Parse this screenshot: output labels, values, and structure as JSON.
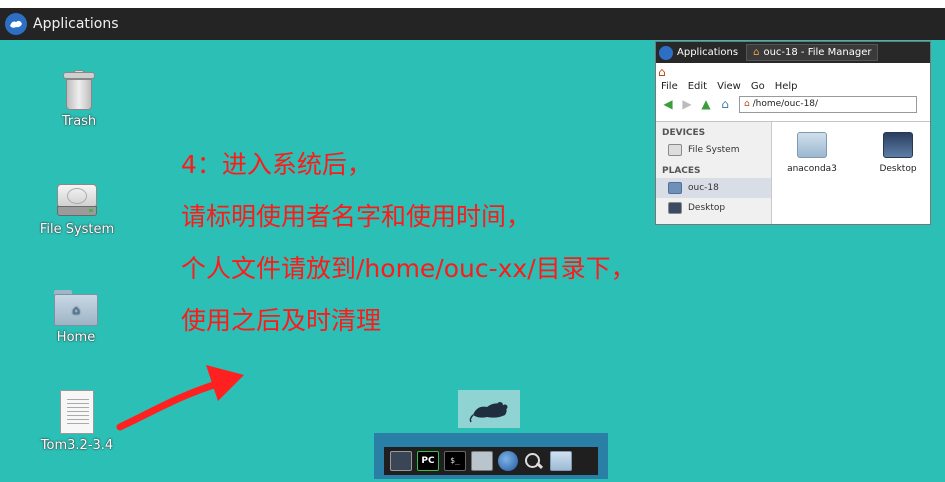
{
  "topbar": {
    "label": "Applications"
  },
  "desktop": {
    "icons": [
      {
        "label": "Trash"
      },
      {
        "label": "File System"
      },
      {
        "label": "Home"
      },
      {
        "label": "Tom3.2-3.4"
      }
    ]
  },
  "annotation": {
    "lines": [
      "4：进入系统后，",
      "请标明使用者名字和使用时间，",
      "个人文件请放到/home/ouc-xx/目录下，",
      "使用之后及时清理"
    ],
    "color": "#ff1a1a"
  },
  "file_manager": {
    "applications_label": "Applications",
    "task_title": "ouc-18 - File Manager",
    "menu": [
      "File",
      "Edit",
      "View",
      "Go",
      "Help"
    ],
    "address": "/home/ouc-18/",
    "devices_header": "DEVICES",
    "devices": [
      "File System"
    ],
    "places_header": "PLACES",
    "places": [
      "ouc-18",
      "Desktop"
    ],
    "files": [
      "anaconda3",
      "Desktop"
    ]
  },
  "dock": {
    "pc_label": "PC",
    "terminal_label": "$_"
  }
}
